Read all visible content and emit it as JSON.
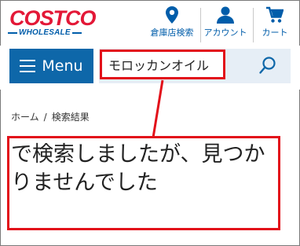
{
  "header": {
    "logo_main": "COSTCO",
    "logo_sub": "WHOLESALE",
    "nav": [
      {
        "label": "倉庫店検索",
        "icon": "location-pin-icon"
      },
      {
        "label": "アカウント",
        "icon": "user-icon"
      },
      {
        "label": "カート",
        "icon": "cart-icon"
      }
    ]
  },
  "toolbar": {
    "menu_label": "Menu",
    "search_value": "モロッカンオイル"
  },
  "breadcrumb": {
    "home": "ホーム",
    "separator": "/",
    "current": "検索結果"
  },
  "result": {
    "message": "で検索しましたが、見つかりませんでした"
  },
  "colors": {
    "brand_red": "#e31837",
    "brand_blue": "#005daa",
    "menu_bg": "#0e67a9",
    "highlight": "#e2101a"
  }
}
